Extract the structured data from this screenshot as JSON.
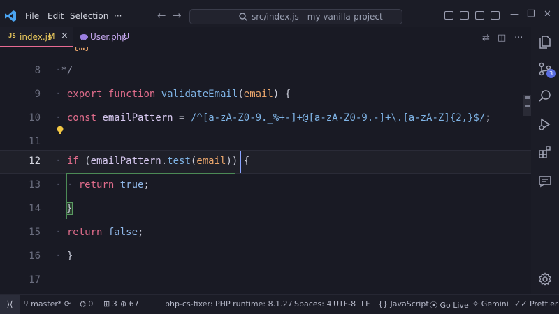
{
  "menu": {
    "file": "File",
    "edit": "Edit",
    "selection": "Selection",
    "more": "···"
  },
  "command_center": {
    "text": "src/index.js - my-vanilla-project"
  },
  "tabs": [
    {
      "lang": "JS",
      "name": "index.js",
      "status": "M",
      "close": "×",
      "color": "#e8c75c"
    },
    {
      "name": "User.php",
      "status": "U",
      "color": "#c6a8f0"
    }
  ],
  "activity_badge": "3",
  "editor": {
    "lines": [
      {
        "num": "",
        "text": "* {…}"
      },
      {
        "num": "8",
        "text": "*/"
      },
      {
        "num": "9",
        "text": "export function validateEmail(email) {"
      },
      {
        "num": "10",
        "text": "const emailPattern = /^[a-zA-Z0-9._%+-]+@[a-zA-Z0-9.-]+\\.[a-zA-Z]{2,}$/;"
      },
      {
        "num": "11",
        "text": ""
      },
      {
        "num": "12",
        "text": "if (emailPattern.test(email)) {"
      },
      {
        "num": "13",
        "text": "return true;"
      },
      {
        "num": "14",
        "text": "}"
      },
      {
        "num": "15",
        "text": "return false;"
      },
      {
        "num": "16",
        "text": "}"
      },
      {
        "num": "17",
        "text": ""
      }
    ]
  },
  "statusbar": {
    "branch": "master*",
    "ports": "0",
    "files": "3",
    "added": "67",
    "phpcs": "php-cs-fixer: PHP runtime: 8.1.27",
    "spaces": "Spaces: 4",
    "encoding": "UTF-8",
    "eol": "LF",
    "language": "JavaScript",
    "golive": "Go Live",
    "gemini": "Gemini",
    "prettier": "Prettier"
  },
  "colors": {
    "accent": "#e86a92",
    "badge": "#5b6ee1"
  }
}
